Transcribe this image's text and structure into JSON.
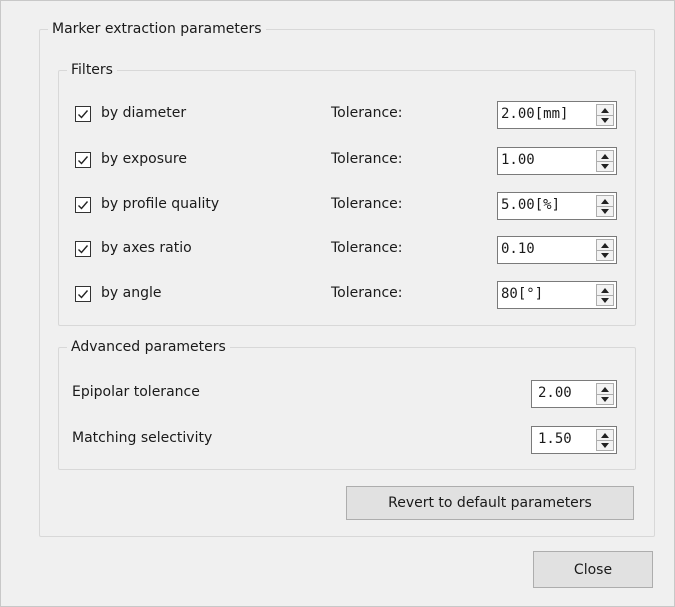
{
  "marker_group": {
    "title": "Marker extraction parameters"
  },
  "filters": {
    "title": "Filters",
    "items": [
      {
        "label": "by diameter",
        "checked": true,
        "tolerance_label": "Tolerance:",
        "value": "2.00[mm]"
      },
      {
        "label": "by exposure",
        "checked": true,
        "tolerance_label": "Tolerance:",
        "value": "1.00"
      },
      {
        "label": "by profile quality",
        "checked": true,
        "tolerance_label": "Tolerance:",
        "value": "5.00[%]"
      },
      {
        "label": "by axes ratio",
        "checked": true,
        "tolerance_label": "Tolerance:",
        "value": "0.10"
      },
      {
        "label": "by angle",
        "checked": true,
        "tolerance_label": "Tolerance:",
        "value": "80[°]"
      }
    ]
  },
  "advanced": {
    "title": "Advanced parameters",
    "epipolar_label": "Epipolar tolerance",
    "epipolar_value": "2.00",
    "matching_label": "Matching selectivity",
    "matching_value": "1.50"
  },
  "buttons": {
    "revert_label": "Revert to default parameters",
    "close_label": "Close"
  },
  "icons": {
    "check": "checkmark-icon",
    "spin_up": "spin-up-icon",
    "spin_down": "spin-down-icon"
  }
}
